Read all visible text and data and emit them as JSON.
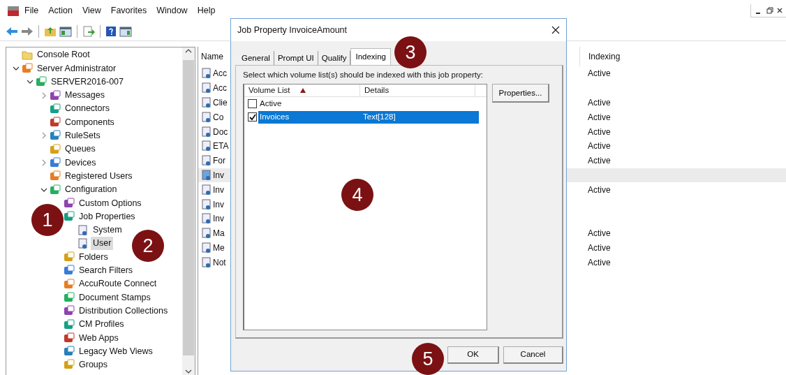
{
  "menu": [
    "File",
    "Action",
    "View",
    "Favorites",
    "Window",
    "Help"
  ],
  "tree": [
    {
      "label": "Console Root",
      "selected": false
    },
    {
      "label": "Server Administrator",
      "selected": false,
      "expanded": true,
      "children": [
        {
          "label": "SERVER2016-007",
          "selected": false,
          "expanded": true,
          "children": [
            {
              "label": "Messages",
              "selected": false,
              "expanded": false
            },
            {
              "label": "Connectors",
              "selected": false
            },
            {
              "label": "Components",
              "selected": false
            },
            {
              "label": "RuleSets",
              "selected": false,
              "expanded": false
            },
            {
              "label": "Queues",
              "selected": false
            },
            {
              "label": "Devices",
              "selected": false,
              "expanded": false
            },
            {
              "label": "Registered Users",
              "selected": false
            },
            {
              "label": "Configuration",
              "selected": false,
              "expanded": true,
              "children": [
                {
                  "label": "Custom Options",
                  "selected": false
                },
                {
                  "label": "Job Properties",
                  "selected": false,
                  "children": [
                    {
                      "label": "System",
                      "selected": false
                    },
                    {
                      "label": "User",
                      "selected": true
                    }
                  ]
                },
                {
                  "label": "Folders",
                  "selected": false
                },
                {
                  "label": "Search Filters",
                  "selected": false
                },
                {
                  "label": "AccuRoute Connect",
                  "selected": false
                },
                {
                  "label": "Document Stamps",
                  "selected": false
                },
                {
                  "label": "Distribution Collections",
                  "selected": false
                },
                {
                  "label": "CM Profiles",
                  "selected": false
                },
                {
                  "label": "Web Apps",
                  "selected": false
                },
                {
                  "label": "Legacy Web Views",
                  "selected": false
                },
                {
                  "label": "Groups",
                  "selected": false
                }
              ]
            }
          ]
        }
      ]
    }
  ],
  "list": {
    "columns": [
      "Name",
      "Indexing"
    ],
    "rows": [
      {
        "name": "Acc",
        "indexing": "Active",
        "selected": false
      },
      {
        "name": "Acc",
        "selected": false
      },
      {
        "name": "Clie",
        "indexing": "Active",
        "selected": false
      },
      {
        "name": "Co",
        "indexing": "Active",
        "selected": false
      },
      {
        "name": "Doc",
        "indexing": "Active",
        "selected": false
      },
      {
        "name": "ETA",
        "indexing": "Active",
        "selected": false
      },
      {
        "name": "For",
        "indexing": "Active",
        "selected": false
      },
      {
        "name": "Inv",
        "selected": true
      },
      {
        "name": "Inv",
        "indexing": "Active",
        "selected": false
      },
      {
        "name": "Inv",
        "selected": false
      },
      {
        "name": "Inv",
        "selected": false
      },
      {
        "name": "Ma",
        "indexing": "Active",
        "selected": false
      },
      {
        "name": "Me",
        "indexing": "Active",
        "selected": false
      },
      {
        "name": "Not",
        "indexing": "Active",
        "selected": false
      }
    ]
  },
  "dialog": {
    "title": "Job Property InvoiceAmount",
    "tabs": [
      {
        "label": "General",
        "selected": false
      },
      {
        "label": "Prompt UI",
        "selected": false
      },
      {
        "label": "Qualify",
        "selected": false
      },
      {
        "label": "Indexing",
        "selected": true
      }
    ],
    "instruction": "Select which volume list(s) should be indexed with this job property:",
    "columns": [
      "Volume List",
      "Details"
    ],
    "rows": [
      {
        "name": "Active",
        "checked": false,
        "selected": false
      },
      {
        "name": "Invoices",
        "details": "Text[128]",
        "checked": true,
        "selected": true
      }
    ],
    "side_button": "Properties...",
    "buttons": [
      "OK",
      "Cancel"
    ]
  },
  "callouts": [
    "1",
    "2",
    "3",
    "4",
    "5"
  ]
}
